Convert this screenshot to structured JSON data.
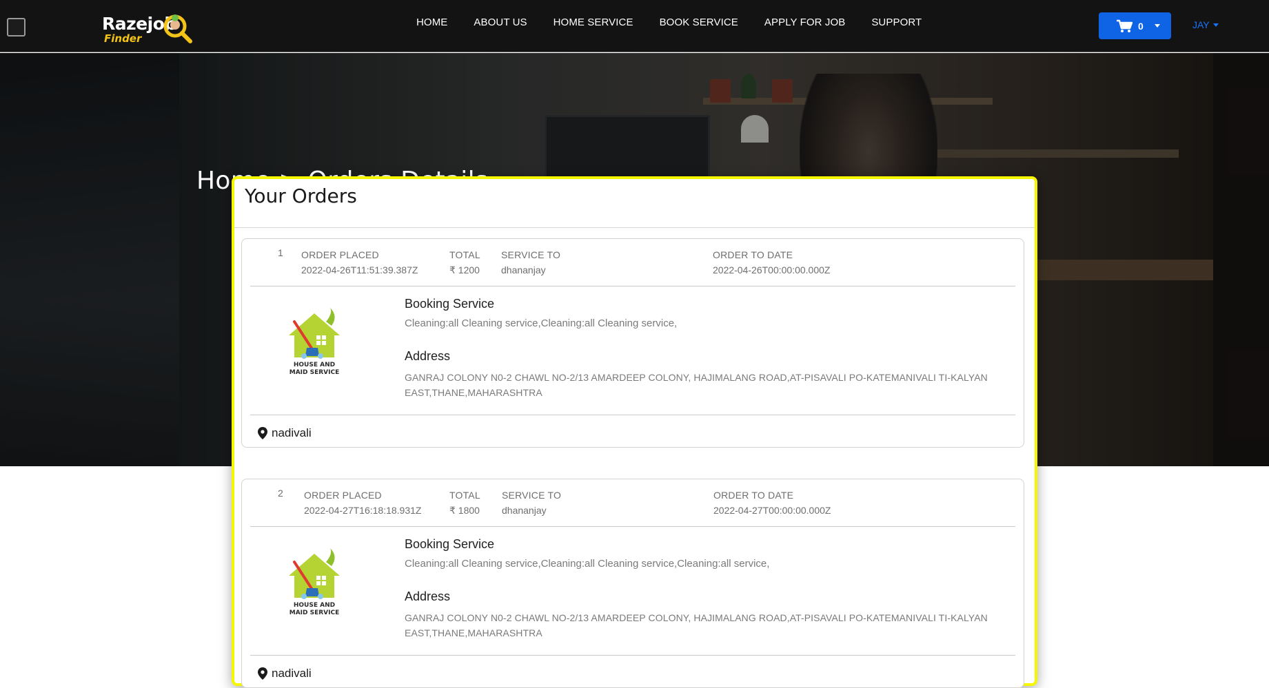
{
  "header": {
    "logo": {
      "line1": "Razejob",
      "line2": "Finder"
    },
    "nav": [
      "HOME",
      "ABOUT US",
      "HOME SERVICE",
      "BOOK SERVICE",
      "APPLY FOR JOB",
      "SUPPORT"
    ],
    "cart_count": "0",
    "user_label": "JAY"
  },
  "hero": {
    "breadcrumb": "Home > Orders Details"
  },
  "orders": {
    "title": "Your Orders",
    "columns": {
      "placed": "ORDER PLACED",
      "total": "TOTAL",
      "service_to": "SERVICE TO",
      "order_to_date": "ORDER TO DATE"
    },
    "labels": {
      "booking": "Booking Service",
      "address": "Address",
      "logo_caption_1": "HOUSE AND",
      "logo_caption_2": "MAID SERVICE"
    },
    "items": [
      {
        "num": "1",
        "placed": "2022-04-26T11:51:39.387Z",
        "total": "₹ 1200",
        "service_to": "dhananjay",
        "order_to_date": "2022-04-26T00:00:00.000Z",
        "booking": "Cleaning:all Cleaning service,Cleaning:all Cleaning service,",
        "address": "GANRAJ COLONY N0-2 CHAWL NO-2/13 AMARDEEP COLONY, HAJIMALANG ROAD,AT-PISAVALI PO-KATEMANIVALI TI-KALYAN EAST,THANE,MAHARASHTRA",
        "location": "nadivali"
      },
      {
        "num": "2",
        "placed": "2022-04-27T16:18:18.931Z",
        "total": "₹ 1800",
        "service_to": "dhananjay",
        "order_to_date": "2022-04-27T00:00:00.000Z",
        "booking": "Cleaning:all Cleaning service,Cleaning:all Cleaning service,Cleaning:all service,",
        "address": "GANRAJ COLONY N0-2 CHAWL NO-2/13 AMARDEEP COLONY, HAJIMALANG ROAD,AT-PISAVALI PO-KATEMANIVALI TI-KALYAN EAST,THANE,MAHARASHTRA",
        "location": "nadivali"
      }
    ]
  },
  "colors": {
    "nav_bg": "#131313",
    "cart_button": "#0f64e6",
    "user_link": "#1a73ff",
    "card_border": "#f6f600",
    "logo_yellow": "#f3c317"
  }
}
